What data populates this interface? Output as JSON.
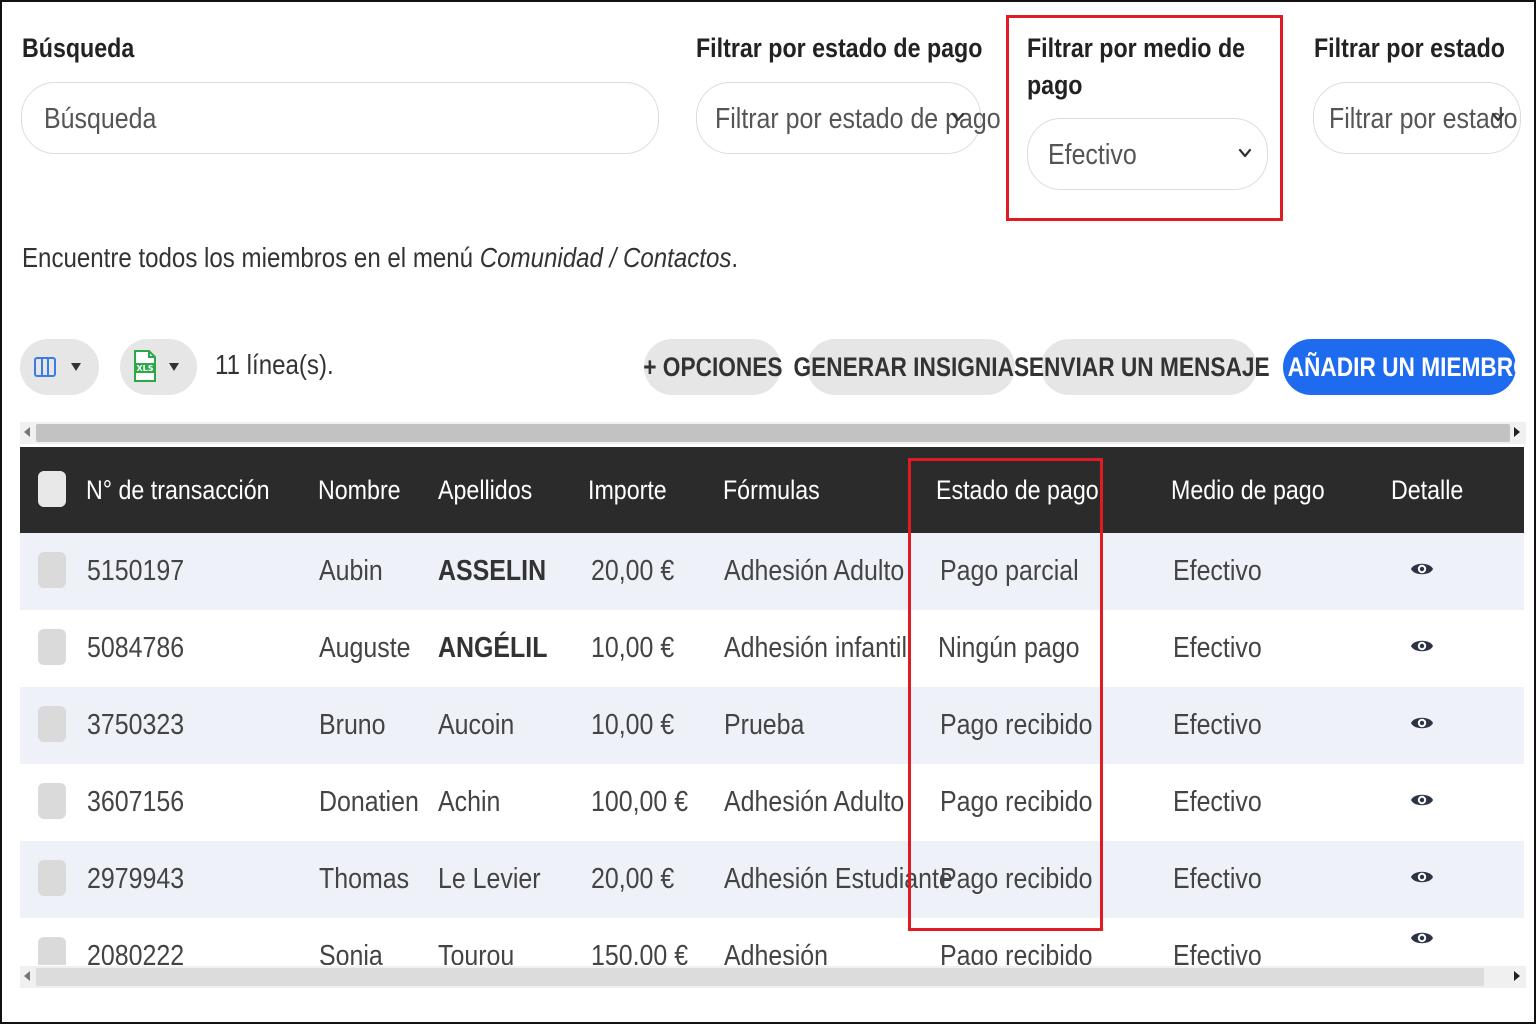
{
  "filters": {
    "search": {
      "label": "Búsqueda",
      "placeholder": "Búsqueda"
    },
    "payment_status": {
      "label": "Filtrar por estado de pago",
      "value": "Filtrar por estado de pago"
    },
    "payment_method": {
      "label": "Filtrar por medio de pago",
      "value": "Efectivo"
    },
    "status": {
      "label": "Filtrar por estado",
      "value": "Filtrar por estado"
    }
  },
  "note": {
    "text": "Encuentre todos los miembros en el menú ",
    "path": "Comunidad / Contactos",
    "end": "."
  },
  "toolbar": {
    "count": "11 línea(s).",
    "options": "+ OPCIONES",
    "badges": "GENERAR INSIGNIAS",
    "message": "ENVIAR UN MENSAJE",
    "add": "+ AÑADIR UN MIEMBRO",
    "export_icon_text": "XLS"
  },
  "table": {
    "headers": [
      "N° de transacción",
      "Nombre",
      "Apellidos",
      "Importe",
      "Fórmulas",
      "Estado de pago",
      "Medio de pago",
      "Detalle"
    ],
    "rows": [
      [
        "5150197",
        "Aubin",
        "ASSELIN",
        "20,00 €",
        "Adhesión Adulto",
        "Pago parcial",
        "Efectivo"
      ],
      [
        "5084786",
        "Auguste",
        "ANGÉLIL",
        "10,00 €",
        "Adhesión infantil",
        "Ningún pago",
        "Efectivo"
      ],
      [
        "3750323",
        "Bruno",
        "Aucoin",
        "10,00 €",
        "Prueba",
        "Pago recibido",
        "Efectivo"
      ],
      [
        "3607156",
        "Donatien",
        "Achin",
        "100,00 €",
        "Adhesión Adulto",
        "Pago recibido",
        "Efectivo"
      ],
      [
        "2979943",
        "Thomas",
        "Le Levier",
        "20,00 €",
        "Adhesión Estudiante",
        "Pago recibido",
        "Efectivo"
      ],
      [
        "2080222",
        "Sonia",
        "Tourou",
        "150,00 €",
        "Adhesión",
        "Pago recibido",
        "Efectivo"
      ]
    ]
  },
  "colors": {
    "primary": "#1f6bf0",
    "highlight": "#e01b24",
    "header_bg": "#2b2b2b",
    "row_alt": "#eef2f8"
  }
}
